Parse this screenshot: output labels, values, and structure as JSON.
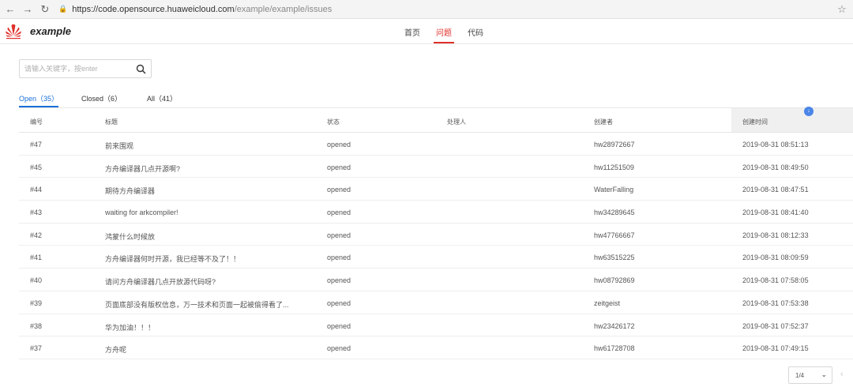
{
  "browser": {
    "url_host": "https://code.opensource.huaweicloud.com",
    "url_path": "/example/example/issues",
    "back_glyph": "←",
    "forward_glyph": "→",
    "reload_glyph": "↻",
    "star_glyph": "☆"
  },
  "app": {
    "name": "example",
    "brand_color": "#e0302b",
    "nav": [
      {
        "label": "首页",
        "active": false
      },
      {
        "label": "问题",
        "active": true
      },
      {
        "label": "代码",
        "active": false
      }
    ]
  },
  "search": {
    "placeholder": "请输入关键字，按enter",
    "value": ""
  },
  "status_tabs": [
    {
      "label": "Open（35）",
      "active": true
    },
    {
      "label": "Closed（6）",
      "active": false
    },
    {
      "label": "All（41）",
      "active": false
    }
  ],
  "table": {
    "headers": [
      "编号",
      "标题",
      "状态",
      "处理人",
      "创建者",
      "创建时间"
    ],
    "sort_badge": "↓",
    "rows": [
      {
        "id": "#47",
        "title": "前来围观",
        "status": "opened",
        "assignee": "",
        "creator": "hw28972667",
        "time": "2019-08-31 08:51:13"
      },
      {
        "id": "#45",
        "title": "方舟编译器几点开源啊?",
        "status": "opened",
        "assignee": "",
        "creator": "hw11251509",
        "time": "2019-08-31 08:49:50"
      },
      {
        "id": "#44",
        "title": "期待方舟编译器",
        "status": "opened",
        "assignee": "",
        "creator": "WaterFalling",
        "time": "2019-08-31 08:47:51"
      },
      {
        "id": "#43",
        "title": "waiting for arkcompiler!",
        "status": "opened",
        "assignee": "",
        "creator": "hw34289645",
        "time": "2019-08-31 08:41:40"
      },
      {
        "id": "#42",
        "title": "鸿蒙什么时候放",
        "status": "opened",
        "assignee": "",
        "creator": "hw47766667",
        "time": "2019-08-31 08:12:33"
      },
      {
        "id": "#41",
        "title": "方舟编译器何时开源，我已经等不及了！！",
        "status": "opened",
        "assignee": "",
        "creator": "hw63515225",
        "time": "2019-08-31 08:09:59"
      },
      {
        "id": "#40",
        "title": "请问方舟编译器几点开放源代码呀?",
        "status": "opened",
        "assignee": "",
        "creator": "hw08792869",
        "time": "2019-08-31 07:58:05"
      },
      {
        "id": "#39",
        "title": "页面底部没有版权信息，万一技术和页面一起被偷得看了...",
        "status": "opened",
        "assignee": "",
        "creator": "zeitgeist",
        "time": "2019-08-31 07:53:38"
      },
      {
        "id": "#38",
        "title": "华为加油！！！",
        "status": "opened",
        "assignee": "",
        "creator": "hw23426172",
        "time": "2019-08-31 07:52:37"
      },
      {
        "id": "#37",
        "title": "方舟呢",
        "status": "opened",
        "assignee": "",
        "creator": "hw61728708",
        "time": "2019-08-31 07:49:15"
      }
    ]
  },
  "pagination": {
    "current": "1/4",
    "chevron": "⌄",
    "prev_glyph": "‹"
  }
}
